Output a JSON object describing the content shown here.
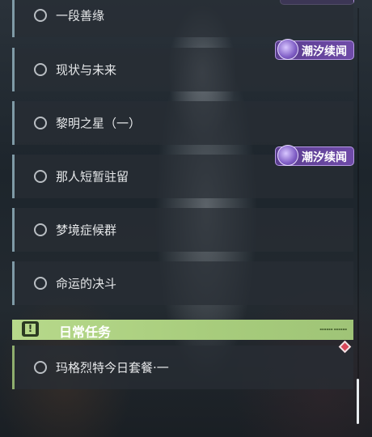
{
  "quests": [
    {
      "label": "一段善缘"
    },
    {
      "label": "现状与未来"
    },
    {
      "label": "黎明之星（一）"
    },
    {
      "label": "那人短暂驻留"
    },
    {
      "label": "梦境症候群"
    },
    {
      "label": "命运的决斗"
    }
  ],
  "badges": [
    "潮汐续闻",
    "潮汐续闻"
  ],
  "daily_section": {
    "icon_glyph": "!",
    "title": "日常任务"
  },
  "daily_quests": [
    {
      "label": "玛格烈特今日套餐·一"
    }
  ],
  "colors": {
    "story_bar": "#7f9aa6",
    "daily_bar": "#8fae6e",
    "section_bg": "#b7d98b",
    "badge_bg": "#6f4ba8",
    "marker": "#d8475a"
  }
}
